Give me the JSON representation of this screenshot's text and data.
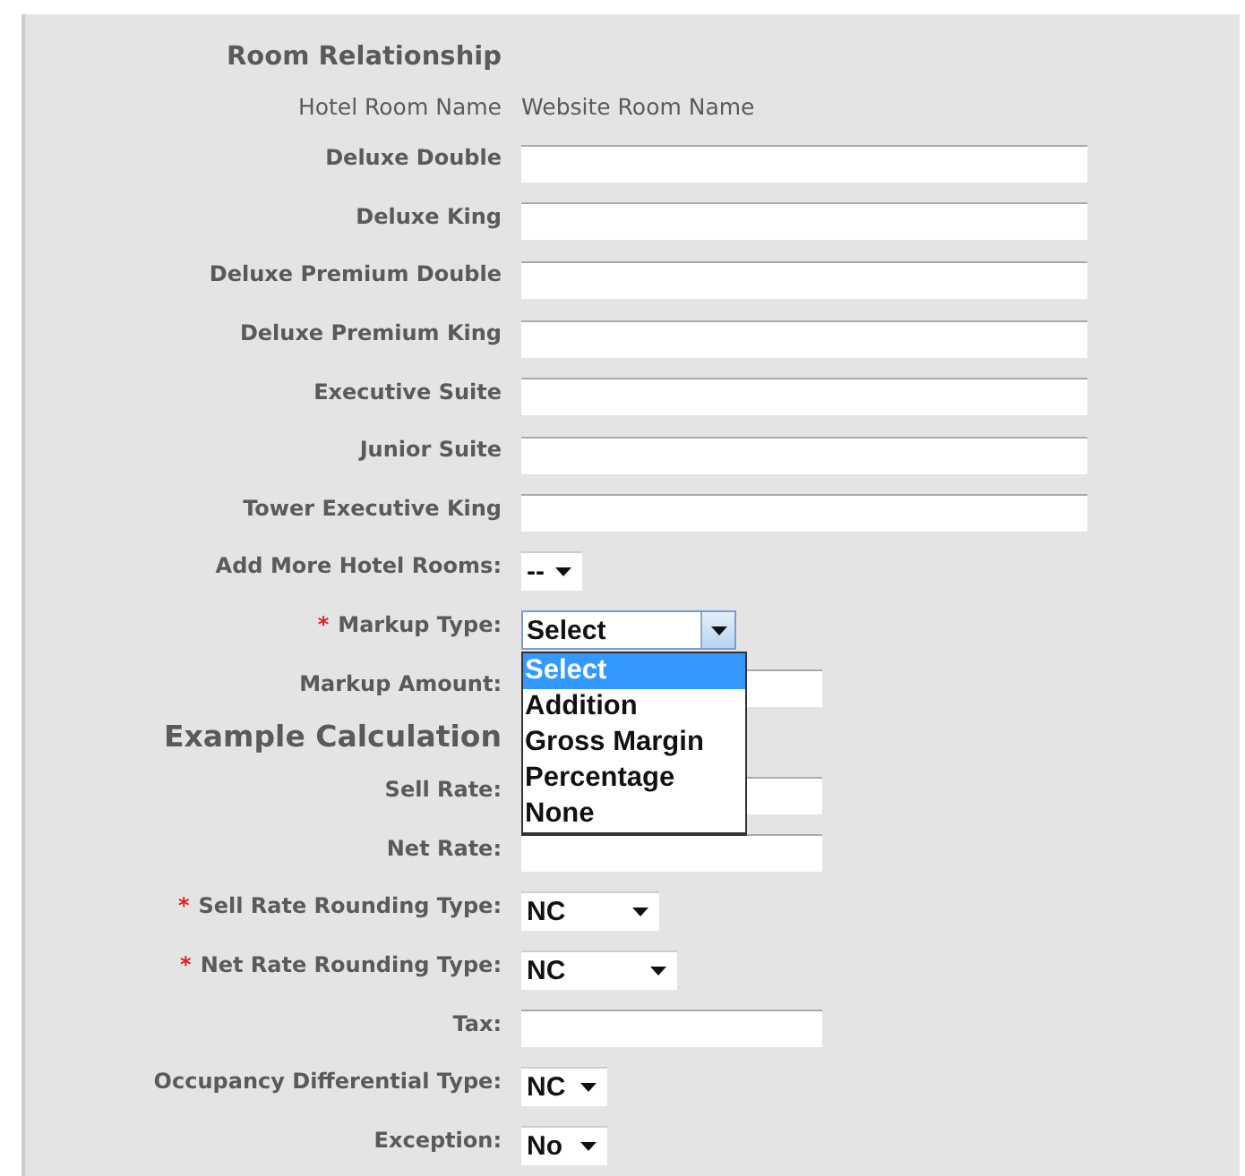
{
  "section_title": "Room Relationship",
  "column_headers": [
    "Hotel Room Name",
    "Website Room Name"
  ],
  "rooms": [
    {
      "name": "Deluxe Double"
    },
    {
      "name": "Deluxe King"
    },
    {
      "name": "Deluxe Premium Double"
    },
    {
      "name": "Deluxe Premium King"
    },
    {
      "name": "Executive Suite"
    },
    {
      "name": "Junior Suite"
    },
    {
      "name": "Tower Executive King"
    }
  ],
  "fields": [
    {
      "kind": "select",
      "label": "Add More Hotel Rooms:",
      "value": "--"
    },
    {
      "kind": "select",
      "label": "Markup Type:",
      "marker": "*",
      "value": "Select",
      "open": true,
      "options": [
        {
          "label": "Select",
          "selected": true
        },
        {
          "label": "Addition",
          "selected": false
        },
        {
          "label": "Gross Margin",
          "selected": false
        },
        {
          "label": "Percentage",
          "selected": false
        },
        {
          "label": "None",
          "selected": false
        }
      ]
    },
    {
      "kind": "text",
      "label": "Markup Amount:"
    },
    {
      "kind": "heading",
      "label": "Example Calculation"
    },
    {
      "kind": "text",
      "label": "Sell Rate:"
    },
    {
      "kind": "text",
      "label": "Net Rate:"
    },
    {
      "kind": "select",
      "label": "Sell Rate Rounding Type:",
      "marker": "*",
      "value": "NC"
    },
    {
      "kind": "select",
      "label": "Net Rate Rounding Type:",
      "marker": "*",
      "value": "NC"
    },
    {
      "kind": "text",
      "label": "Tax:"
    },
    {
      "kind": "select",
      "label": "Occupancy Differential Type:",
      "value": "NC"
    },
    {
      "kind": "select",
      "label": "Exception:",
      "value": "No"
    }
  ]
}
